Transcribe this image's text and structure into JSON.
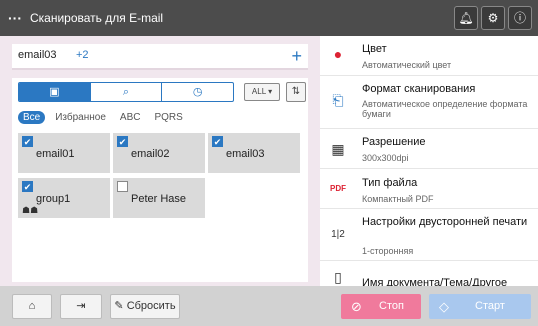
{
  "header": {
    "title": "Сканировать для E-mail",
    "menu_icon": "ellipsis-icon",
    "icons": [
      "bell-icon",
      "network-icon",
      "info-icon"
    ]
  },
  "destination": {
    "chip": "email03",
    "count": "+2",
    "add_label": "+"
  },
  "addressbook": {
    "all_dropdown": "ALL ▾",
    "filters": [
      "Все",
      "Избранное",
      "ABC",
      "PQRS"
    ],
    "tiles": [
      {
        "name": "email01",
        "checked": "✔",
        "type": "person"
      },
      {
        "name": "email02",
        "checked": "✔",
        "type": "person"
      },
      {
        "name": "email03",
        "checked": "✔",
        "type": "person"
      },
      {
        "name": "group1",
        "checked": "✔",
        "type": "group"
      },
      {
        "name": "Peter Hase",
        "checked": "",
        "type": "person"
      }
    ]
  },
  "settings": [
    {
      "title": "Цвет",
      "value": "Автоматический цвет",
      "icon": "color-icon"
    },
    {
      "title": "Формат сканирования",
      "value": "Автоматическое определение формата бумаги",
      "icon": "scan-size-icon"
    },
    {
      "title": "Разрешение",
      "value": "300x300dpi",
      "icon": "resolution-icon"
    },
    {
      "title": "Тип файла",
      "value": "Компактный PDF",
      "icon": "pdf-icon"
    },
    {
      "title": "Настройки двусторонней печати",
      "value": "1-сторонняя",
      "icon": "duplex-icon"
    },
    {
      "title": "Имя документа/Тема/Другое",
      "value": "",
      "icon": "document-icon"
    }
  ],
  "footer": {
    "reset_label": "Сбросить",
    "stop_label": "Стоп",
    "start_label": "Старт"
  },
  "colors": {
    "accent": "#2b78c2",
    "stop": "#f07a9c",
    "start": "#a9c8ee",
    "title_bar": "#4c4c4c"
  }
}
